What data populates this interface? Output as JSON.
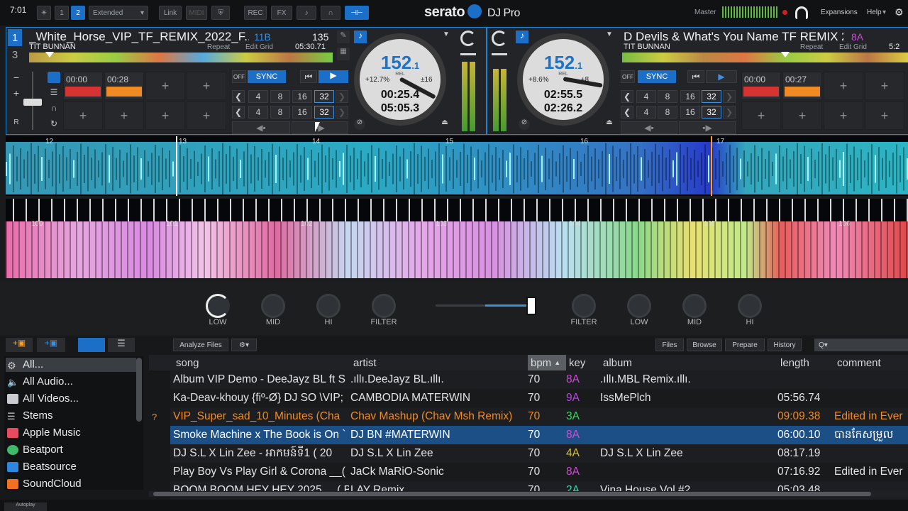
{
  "topbar": {
    "time": "7:01",
    "deck1": "1",
    "deck2": "2",
    "mode": "Extended",
    "link": "Link",
    "midi": "MIDI",
    "rec": "REC",
    "fx": "FX",
    "app_name": "serato",
    "app_sub": "DJ Pro",
    "master": "Master",
    "expansions": "Expansions",
    "help": "Help"
  },
  "deck_left": {
    "num_top": "1",
    "num_bottom": "3",
    "title": "_White_Horse_VIP_TF_REMIX_2022_F...",
    "key": "11B",
    "bpm_small": "135",
    "artist": "TIT BUNNAN",
    "repeat": "Repeat",
    "edit_grid": "Edit Grid",
    "remain": "05:30.71",
    "cue1_time": "00:00",
    "cue2_time": "00:28",
    "off": "OFF",
    "sync": "SYNC",
    "loops_row1": [
      "4",
      "8",
      "16",
      "32"
    ],
    "loops_row2": [
      "4",
      "8",
      "16",
      "32"
    ],
    "platter_bpm": "152",
    "platter_bpm_dec": ".1",
    "platter_rel": "REL",
    "pitch": "+12.7%",
    "range": "±16",
    "elapsed": "00:25.4",
    "remaining": "05:05.3",
    "rotation_deg": 118
  },
  "deck_right": {
    "title": "D Devils & What's You Name TF REMIX 2...",
    "key": "8A",
    "bpm_small": "",
    "artist": "TIT BUNNAN",
    "repeat": "Repeat",
    "edit_grid": "Edit Grid",
    "remain": "5:2",
    "cue1_time": "00:00",
    "cue2_time": "00:27",
    "off": "OFF",
    "sync": "SYNC",
    "loops_row1": [
      "4",
      "8",
      "16",
      "32"
    ],
    "loops_row2": [
      "4",
      "8",
      "16",
      "32"
    ],
    "platter_bpm": "152",
    "platter_bpm_dec": ".1",
    "platter_rel": "REL",
    "pitch": "+8.6%",
    "range": "±8",
    "elapsed": "02:55.5",
    "remaining": "02:26.2",
    "rotation_deg": 100
  },
  "wave_top_beats": [
    "12",
    "13",
    "14",
    "15",
    "16",
    "17"
  ],
  "wave_bottom_beats": [
    "100",
    "101",
    "102",
    "103",
    "104",
    "105",
    "106"
  ],
  "mixer": {
    "left": [
      "LOW",
      "MID",
      "HI",
      "FILTER"
    ],
    "right": [
      "FILTER",
      "LOW",
      "MID",
      "HI"
    ]
  },
  "library": {
    "analyze": "Analyze Files",
    "files": "Files",
    "browse": "Browse",
    "prepare": "Prepare",
    "history": "History",
    "search_placeholder": "Q▾",
    "autoplay": "Autoplay"
  },
  "sidebar": [
    "All...",
    "All Audio...",
    "All Videos...",
    "Stems",
    "Apple Music",
    "Beatport",
    "Beatsource",
    "SoundCloud"
  ],
  "columns": {
    "song": "song",
    "artist": "artist",
    "bpm": "bpm",
    "key": "key",
    "album": "album",
    "length": "length",
    "comment": "comment"
  },
  "tracks": [
    {
      "flag": "",
      "song": "Album VIP Demo - DeeJayz BL ft S",
      "artist": ".ıllı.DeeJayz BL.ıllı.",
      "bpm": "70",
      "key": "8A",
      "key_color": "#d04ad6",
      "album": ".ıllı.MBL Remix.ıllı.",
      "length": "",
      "comment": "",
      "style": "normal"
    },
    {
      "flag": "",
      "song": "Ka-Deav-khouy {ﬁº-Ø} DJ SO \\VIP;",
      "artist": "CAMBODIA MATERWIN",
      "bpm": "70",
      "key": "9A",
      "key_color": "#b84ae0",
      "album": "IssMePlch",
      "length": "05:56.74",
      "comment": "",
      "style": "normal"
    },
    {
      "flag": "?",
      "song": "VIP_Super_sad_10_Minutes (Cha",
      "artist": "Chav Mashup (Chav Msh Remix)",
      "bpm": "70",
      "key": "3A",
      "key_color": "#3ad65a",
      "album": "",
      "length": "09:09.38",
      "comment": "Edited in Ever",
      "style": "orange"
    },
    {
      "flag": "",
      "song": "Smoke Machine x The Book is On `",
      "artist": "DJ BN #MATERWIN",
      "bpm": "70",
      "key": "8A",
      "key_color": "#d04ad6",
      "album": "",
      "length": "06:00.10",
      "comment": "បានកែសម្រួល",
      "style": "selected"
    },
    {
      "flag": "",
      "song": "DJ S.L X Lin Zee - អាកមន៍ទី1 ( 20",
      "artist": "DJ S.L X Lin Zee",
      "bpm": "70",
      "key": "4A",
      "key_color": "#d6c23a",
      "album": "DJ S.L X Lin Zee",
      "length": "08:17.19",
      "comment": "",
      "style": "normal"
    },
    {
      "flag": "",
      "song": "Play Boy Vs Play Girl & Corona __(",
      "artist": "JaCk MaRiO-Sonic",
      "bpm": "70",
      "key": "8A",
      "key_color": "#d04ad6",
      "album": "",
      "length": "07:16.92",
      "comment": "Edited in Ever",
      "style": "normal"
    },
    {
      "flag": "",
      "song": "BOOM BOOM HEY HEY 2025 __( B",
      "artist": "LAY Remix",
      "bpm": "70",
      "key": "2A",
      "key_color": "#3ad6b0",
      "album": "Vina House Vol #2",
      "length": "05:03.48",
      "comment": "",
      "style": "normal"
    }
  ]
}
